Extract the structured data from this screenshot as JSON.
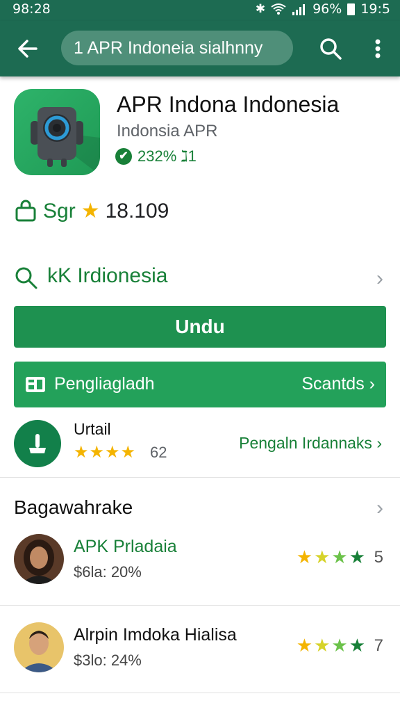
{
  "status_bar": {
    "time": "98:28",
    "battery": "96%",
    "clock_right": "19:5",
    "icons": [
      "bluetooth-icon",
      "wifi-icon",
      "signal-icon",
      "battery-icon"
    ]
  },
  "app_bar": {
    "search_text": "1 APR Indoneia sialhnny",
    "icons": [
      "back-arrow-icon",
      "search-icon",
      "more-vert-icon"
    ]
  },
  "app": {
    "title": "APR Indona Indonesia",
    "developer": "Indonsia APR",
    "meta": "232% ℷ1"
  },
  "rating": {
    "label": "Sgr",
    "value": "18.109"
  },
  "similar": {
    "label": "kK Irdionesia"
  },
  "install_button": "Undu",
  "update_bar": {
    "label": "Pengliagladh",
    "action": "Scantds"
  },
  "review_summary": {
    "title": "Urtail",
    "stars": 4,
    "count": "62",
    "link": "Pengaln Irdannaks"
  },
  "section": {
    "title": "Bagawahrake"
  },
  "reviews": [
    {
      "name": "APK Prladaia",
      "sub": "$6la: 20%",
      "score": "5",
      "name_color": "#188038"
    },
    {
      "name": "Alrpin Imdoka Hialisa",
      "sub": "$3lo: 24%",
      "score": "7",
      "name_color": "#111111"
    }
  ],
  "colors": {
    "app_bar": "#1d6b52",
    "primary_green": "#1e9150",
    "accent_green": "#188038",
    "star_yellow": "#f4b400"
  }
}
